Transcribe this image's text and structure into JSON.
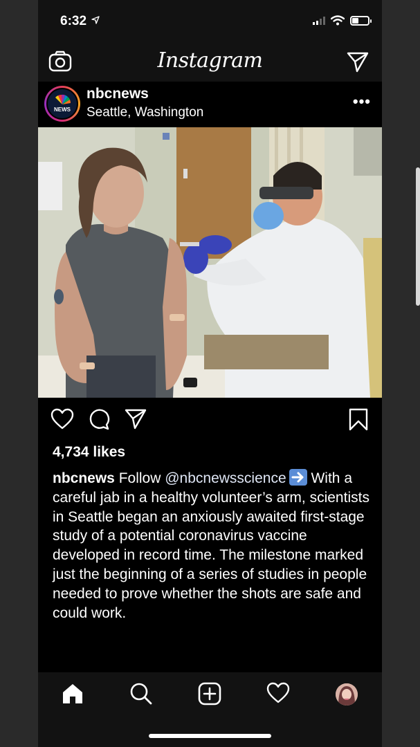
{
  "status": {
    "time": "6:32"
  },
  "nav": {
    "logo": "Instagram"
  },
  "post": {
    "username": "nbcnews",
    "avatar_text": "NEWS",
    "location": "Seattle, Washington",
    "more": "•••",
    "likes": "4,734 likes",
    "caption": {
      "username": "nbcnews",
      "follow": "Follow",
      "mention": "@nbcnewsscience",
      "text": "With a careful jab in a healthy volunteer’s arm, scientists in Seattle began an anxiously awaited first-stage study of a potential coronavirus vaccine developed in record time. The milestone marked just the beginning of a series of studies in people needed to prove whether the shots are safe and could work."
    }
  },
  "colors": {
    "background": "#000000",
    "bar": "#121212",
    "accent_emoji": "#5b8dd6"
  },
  "icons": {
    "top": [
      "camera-icon",
      "direct-message-icon"
    ],
    "actions": [
      "heart-icon",
      "comment-icon",
      "share-icon",
      "bookmark-icon"
    ],
    "bottom": [
      "home-icon",
      "search-icon",
      "new-post-icon",
      "activity-icon",
      "profile-avatar"
    ]
  }
}
